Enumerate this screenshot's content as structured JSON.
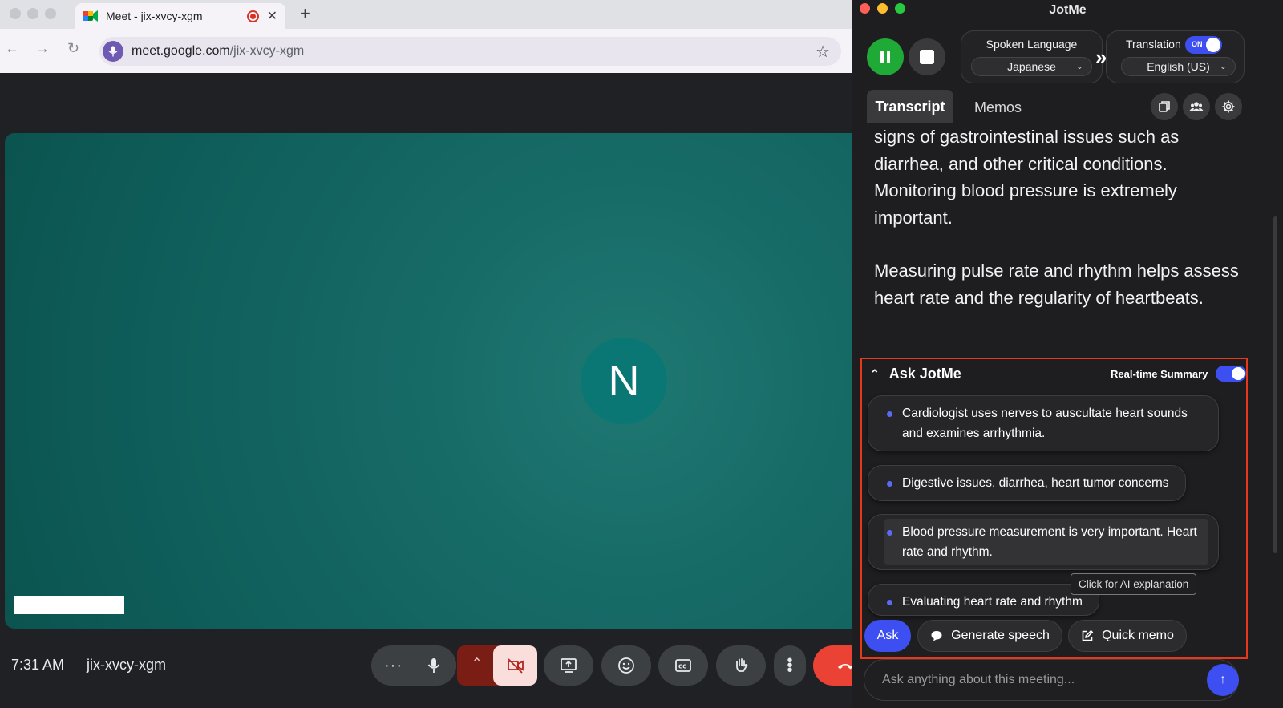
{
  "browser": {
    "tab_title": "Meet - jix-xvcy-xgm",
    "url_host": "meet.google.com",
    "url_path": "/jix-xvcy-xgm"
  },
  "meet": {
    "avatar_initial": "N",
    "time": "7:31 AM",
    "meeting_code": "jix-xvcy-xgm",
    "colors": {
      "tile": "#176b67",
      "avatar": "#0b7775",
      "hangup": "#ea4335"
    }
  },
  "jotme": {
    "title": "JotMe",
    "spoken_language_label": "Spoken Language",
    "spoken_language_value": "Japanese",
    "translation_label": "Translation",
    "translation_toggle": "ON",
    "translation_language_value": "English (US)",
    "tabs": [
      {
        "label": "Transcript",
        "active": true
      },
      {
        "label": "Memos",
        "active": false
      }
    ],
    "transcript": [
      "signs of gastrointestinal issues such as diarrhea, and other critical conditions. Monitoring blood pressure is extremely important.",
      "Measuring pulse rate and rhythm helps assess heart rate and the regularity of heartbeats."
    ],
    "ask": {
      "title": "Ask JotMe",
      "realtime_label": "Real-time Summary",
      "items": [
        "Cardiologist uses nerves to auscultate heart sounds and examines arrhythmia.",
        "Digestive issues, diarrhea, heart tumor concerns",
        "Blood pressure measurement is very important. Heart rate and rhythm.",
        "Evaluating heart rate and rhythm"
      ],
      "tooltip": "Click for AI explanation",
      "ask_button": "Ask",
      "generate_button": "Generate speech",
      "memo_button": "Quick memo",
      "input_placeholder": "Ask anything about this meeting..."
    },
    "colors": {
      "accent": "#3d4ff0",
      "record": "#1fa936",
      "highlight_border": "#e8381b"
    }
  }
}
